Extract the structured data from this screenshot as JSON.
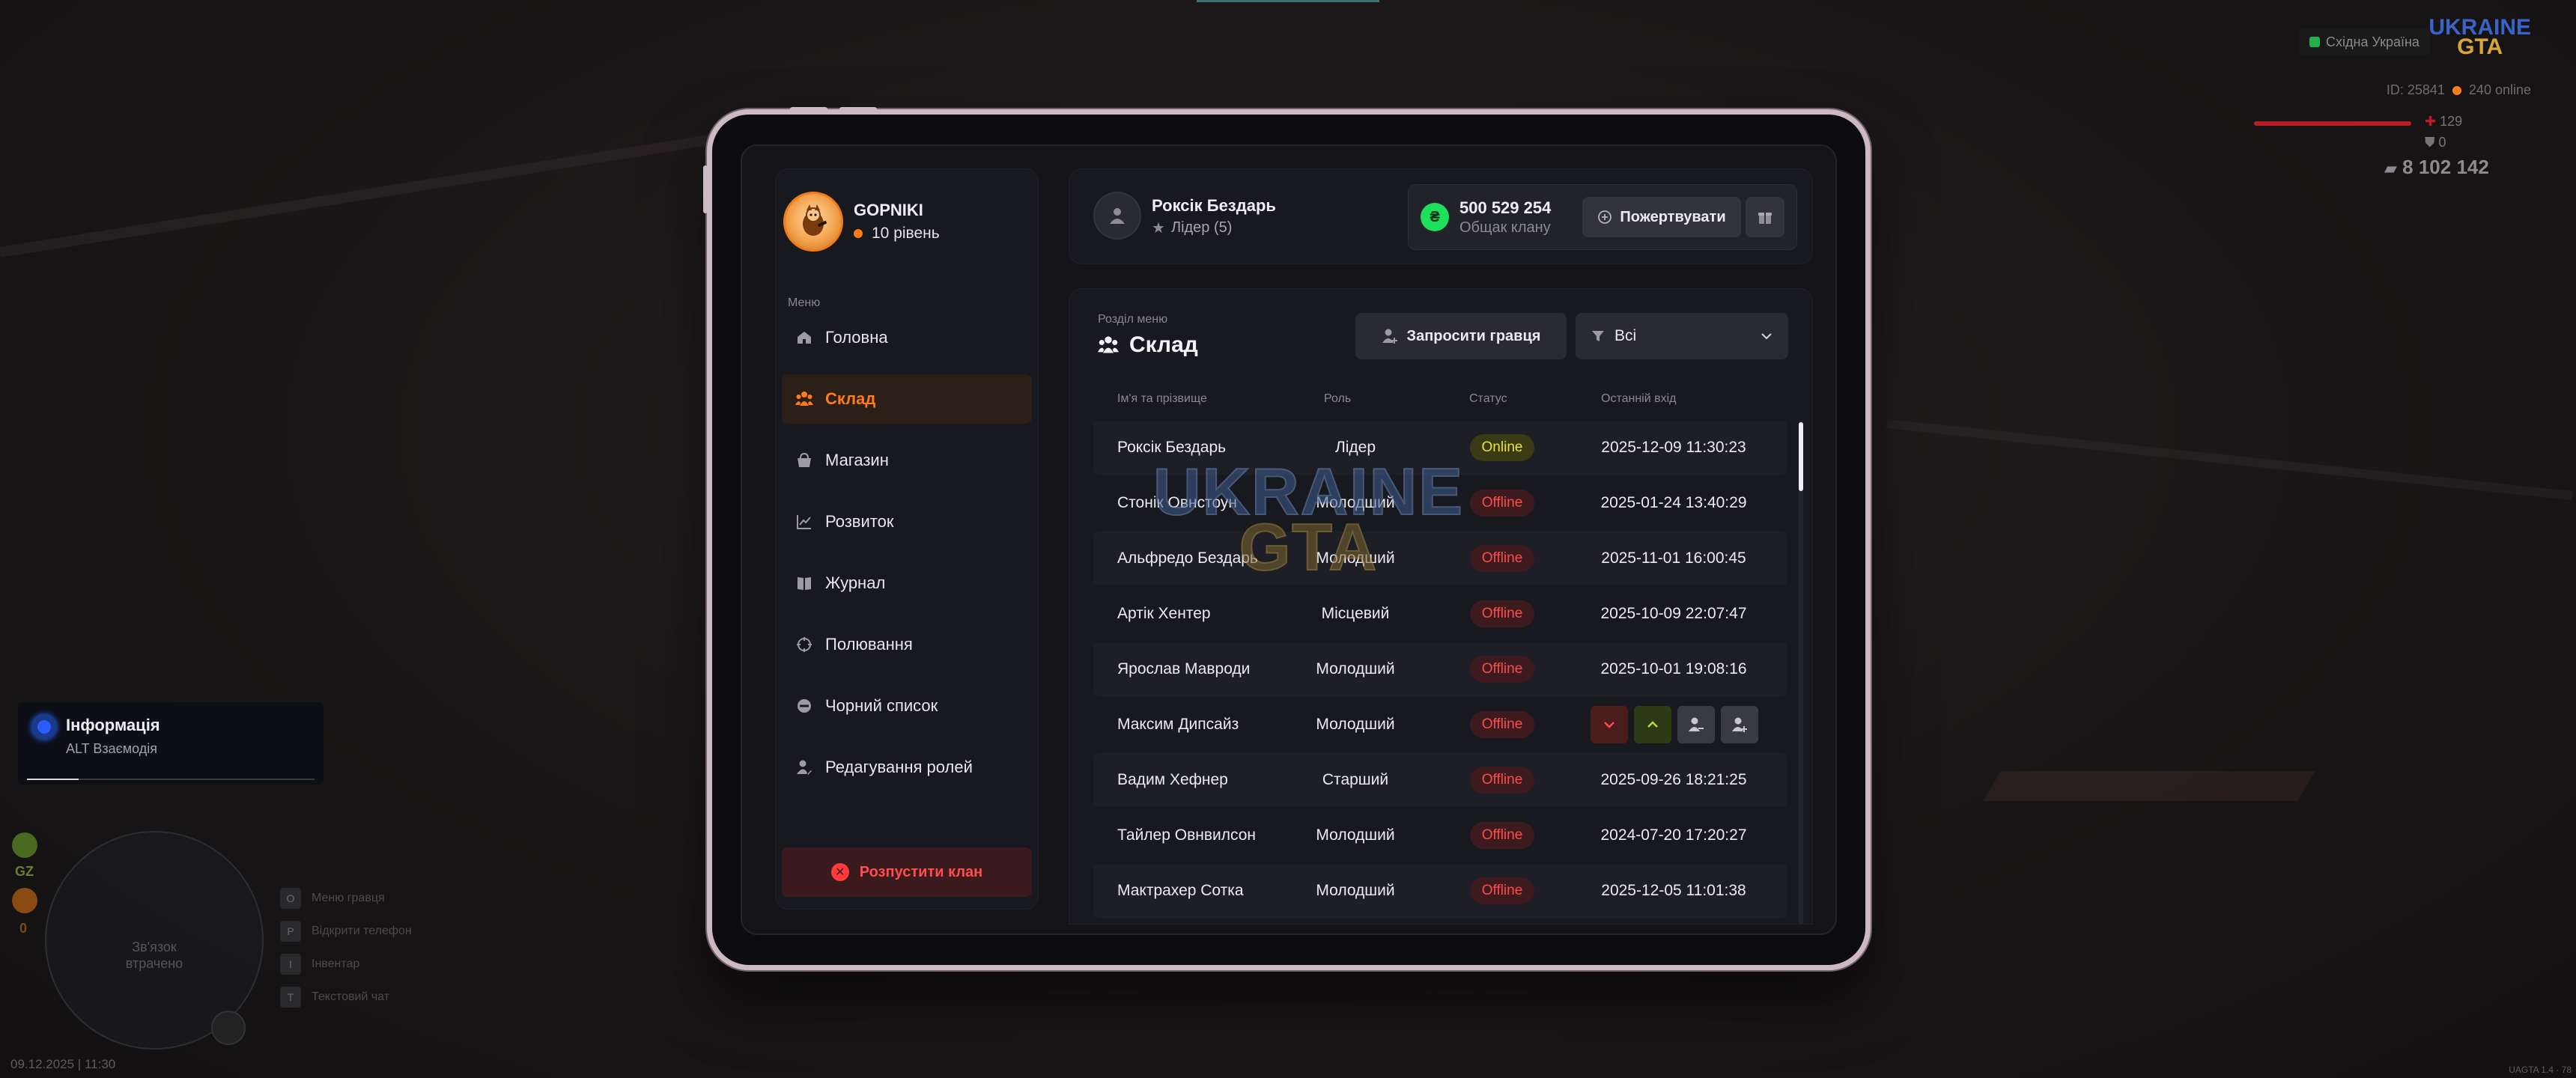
{
  "clan": {
    "name": "GOPNIKI",
    "level": "10 рівень"
  },
  "sidebar": {
    "caption": "Меню",
    "items": [
      {
        "label": "Головна",
        "icon": "home-icon"
      },
      {
        "label": "Склад",
        "icon": "users-icon"
      },
      {
        "label": "Магазин",
        "icon": "shop-icon"
      },
      {
        "label": "Розвиток",
        "icon": "chart-icon"
      },
      {
        "label": "Журнал",
        "icon": "book-icon"
      },
      {
        "label": "Полювання",
        "icon": "crosshair-icon"
      },
      {
        "label": "Чорний список",
        "icon": "ban-icon"
      },
      {
        "label": "Редагування ролей",
        "icon": "person-edit-icon"
      }
    ],
    "dissolve_label": "Розпустити клан"
  },
  "player": {
    "name": "Роксік Бездарь",
    "role": "Лідер (5)"
  },
  "bank": {
    "amount": "500 529 254",
    "label": "Общак клану",
    "donate_label": "Пожертвувати"
  },
  "section": {
    "caption": "Розділ меню",
    "title": "Склад",
    "invite_label": "Запросити гравця",
    "filter_value": "Всі"
  },
  "table": {
    "headers": {
      "name": "Ім'я та прізвище",
      "role": "Роль",
      "status": "Статус",
      "last": "Останній вхід"
    },
    "rows": [
      {
        "name": "Роксік Бездарь",
        "role": "Лідер",
        "status": "Online",
        "last": "2025-12-09 11:30:23"
      },
      {
        "name": "Стонік Овнстоун",
        "role": "Молодший",
        "status": "Offline",
        "last": "2025-01-24 13:40:29"
      },
      {
        "name": "Альфредо Бездарь",
        "role": "Молодший",
        "status": "Offline",
        "last": "2025-11-01 16:00:45"
      },
      {
        "name": "Артік Хентер",
        "role": "Місцевий",
        "status": "Offline",
        "last": "2025-10-09 22:07:47"
      },
      {
        "name": "Ярослав Мавроди",
        "role": "Молодший",
        "status": "Offline",
        "last": "2025-10-01 19:08:16"
      },
      {
        "name": "Максим Дипсайз",
        "role": "Молодший",
        "status": "Offline",
        "last": ""
      },
      {
        "name": "Вадим Хефнер",
        "role": "Старший",
        "status": "Offline",
        "last": "2025-09-26 18:21:25"
      },
      {
        "name": "Тайлер Овнвилсон",
        "role": "Молодший",
        "status": "Offline",
        "last": "2024-07-20 17:20:27"
      },
      {
        "name": "Мактрахер Сотка",
        "role": "Молодший",
        "status": "Offline",
        "last": "2025-12-05 11:01:38"
      }
    ]
  },
  "watermark": {
    "line1": "UKRAINE",
    "line2": "GTA"
  },
  "hud": {
    "region": "Східна Україна",
    "logo_line1": "UKRAINE",
    "logo_line2": "GTA",
    "player_id": "ID: 25841",
    "online": "240 online",
    "health": "129",
    "armor": "0",
    "money": "8 102 142",
    "notification_title": "Інформація",
    "notification_sub": "ALT Взаємодія",
    "notification_progress": 0.18,
    "gz_label": "GZ",
    "zero_label": "0",
    "minimap_text_1": "Зв'язок",
    "minimap_text_2": "втрачено",
    "hints": [
      {
        "key": "O",
        "label": "Меню гравця"
      },
      {
        "key": "P",
        "label": "Відкрити телефон"
      },
      {
        "key": "I",
        "label": "Інвентар"
      },
      {
        "key": "T",
        "label": "Текстовий чат"
      }
    ],
    "datetime": "09.12.2025 | 11:30",
    "version": "UAGTA 1.4 · 78"
  },
  "colors": {
    "accent": "#ff7a1a",
    "online": "#e8e43a",
    "offline": "#ff4b4b",
    "bank_green": "#1ee05a",
    "frame": "#cdb9c3"
  }
}
